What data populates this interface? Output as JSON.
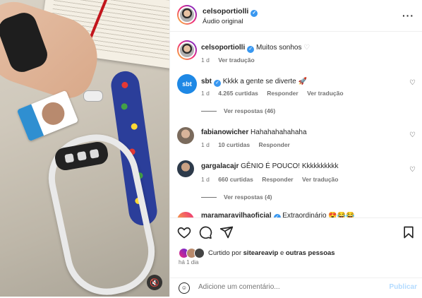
{
  "header": {
    "username": "celsoportiolli",
    "subtitle": "Áudio original",
    "more_icon": "more-horizontal-icon"
  },
  "caption": {
    "username": "celsoportiolli",
    "text": "Muitos sonhos",
    "time": "1 d",
    "translate": "Ver tradução"
  },
  "comments": [
    {
      "username": "sbt",
      "text": "Kkkk a gente se diverte",
      "time": "1 d",
      "likes": "4.265 curtidas",
      "reply": "Responder",
      "translate": "Ver tradução",
      "view_replies": "Ver respostas (46)"
    },
    {
      "username": "fabianowicher",
      "text": "Hahahahahahaha",
      "time": "1 d",
      "likes": "10 curtidas",
      "reply": "Responder"
    },
    {
      "username": "gargalacajr",
      "text": "GÊNIO É POUCO! Kkkkkkkkkk",
      "time": "1 d",
      "likes": "660 curtidas",
      "reply": "Responder",
      "translate": "Ver tradução",
      "view_replies": "Ver respostas (4)"
    },
    {
      "username": "maramaravilhaoficial",
      "text": "Extraordinário"
    }
  ],
  "actions": {
    "liked_prefix": "Curtido por",
    "liked_user": "sitearea​vip",
    "liked_suffix": "e",
    "liked_others": "outras pessoas",
    "date": "há 1 dia",
    "comment_placeholder": "Adicione um comentário...",
    "publish": "Publicar"
  },
  "colors": {
    "verified": "#3897f0",
    "publish": "#b3dbff",
    "sbt_blue": "#1e88e5"
  }
}
